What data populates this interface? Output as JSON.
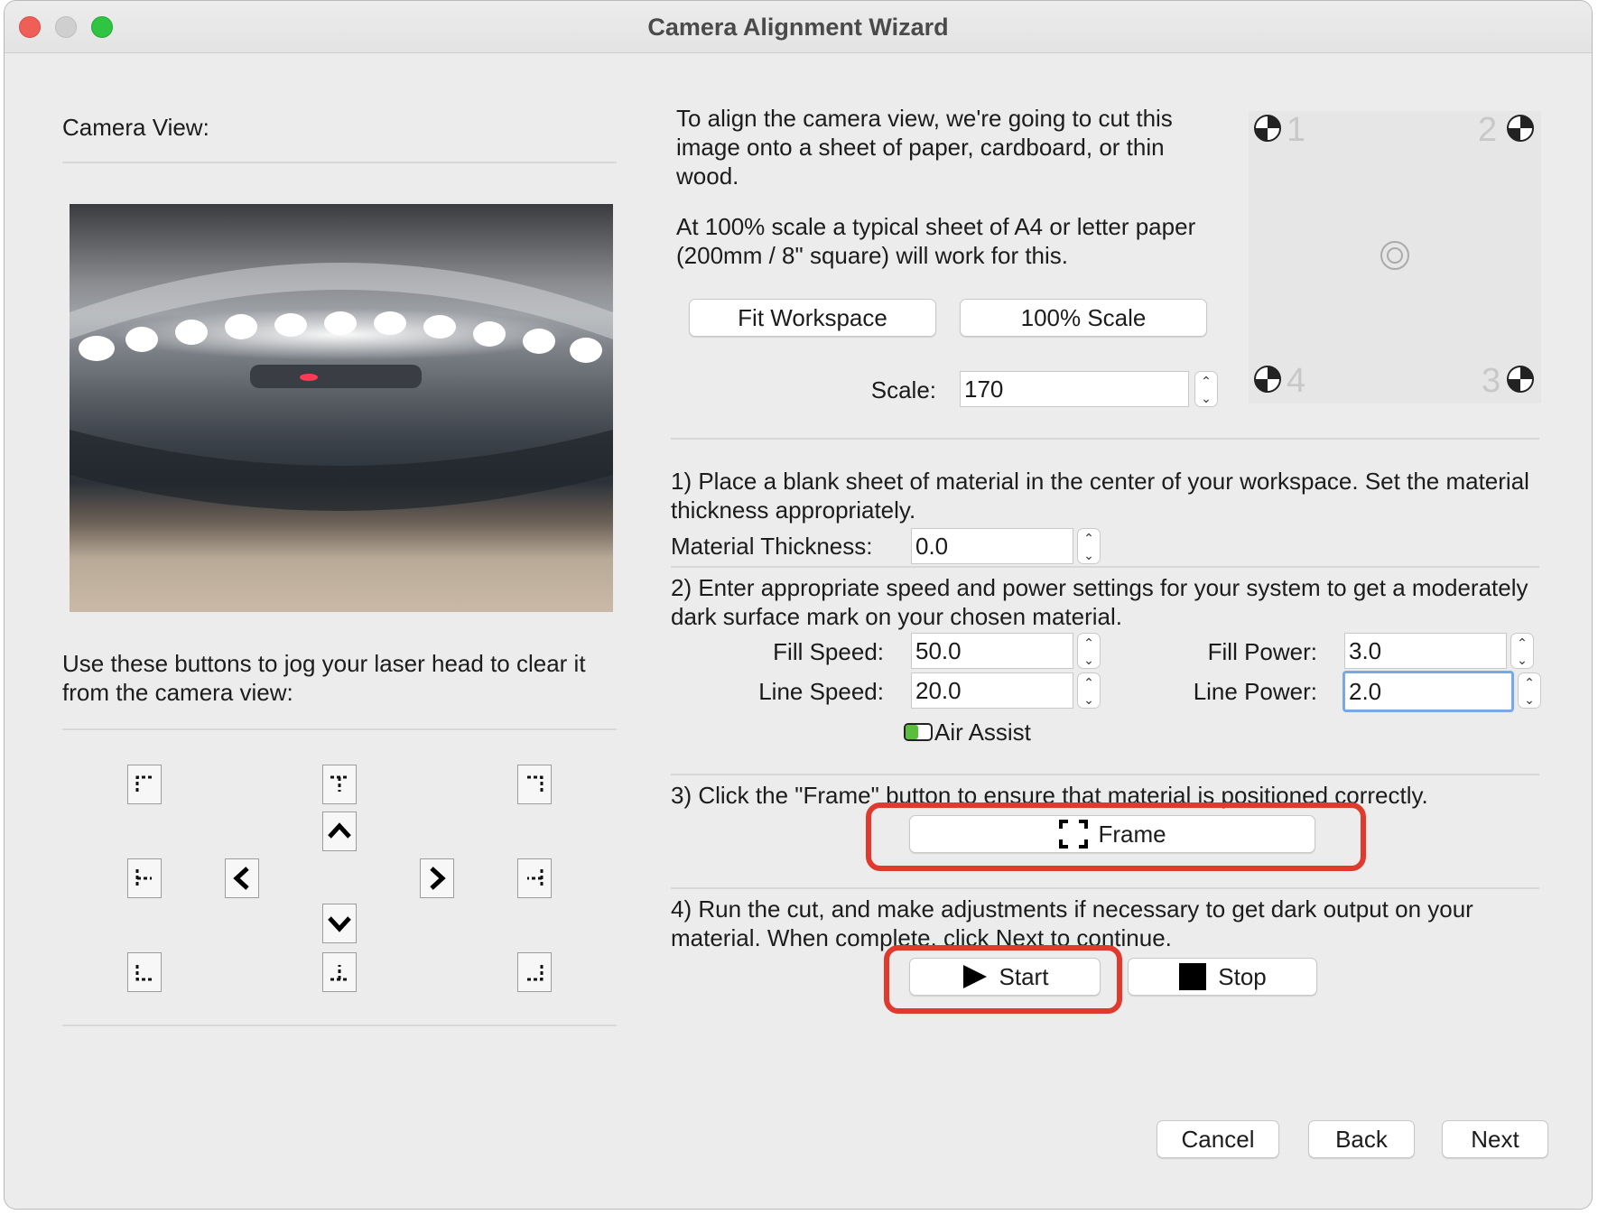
{
  "window": {
    "title": "Camera Alignment Wizard"
  },
  "left": {
    "camera_label": "Camera View:",
    "jog_text": "Use these buttons to jog your laser head to clear it from the camera view:"
  },
  "preview": {
    "intro": "To align the camera view, we're going to cut this image onto a sheet of paper, cardboard, or thin wood.",
    "scale_note": "At 100% scale a typical sheet of A4 or letter paper (200mm / 8\" square) will work for this.",
    "fit_workspace": "Fit Workspace",
    "scale_100": "100% Scale",
    "scale_label": "Scale:",
    "scale_value": "170",
    "corner_numbers": [
      "1",
      "2",
      "3",
      "4"
    ]
  },
  "step1": {
    "text": "1) Place a blank sheet of material in the center of your workspace. Set the material thickness appropriately.",
    "thickness_label": "Material Thickness:",
    "thickness_value": "0.0"
  },
  "step2": {
    "text": "2) Enter appropriate speed and power settings for your system to get a moderately dark surface mark on your chosen material.",
    "fill_speed_label": "Fill Speed:",
    "fill_speed_value": "50.0",
    "fill_power_label": "Fill Power:",
    "fill_power_value": "3.0",
    "line_speed_label": "Line Speed:",
    "line_speed_value": "20.0",
    "line_power_label": "Line Power:",
    "line_power_value": "2.0",
    "air_assist_label": "Air Assist"
  },
  "step3": {
    "text": "3) Click the \"Frame\" button to ensure that material is positioned correctly.",
    "frame_button": "Frame"
  },
  "step4": {
    "text": "4) Run the cut, and make adjustments if necessary to get dark output on your material. When complete, click Next to continue.",
    "start_button": "Start",
    "stop_button": "Stop"
  },
  "footer": {
    "cancel": "Cancel",
    "back": "Back",
    "next": "Next"
  },
  "colors": {
    "highlight": "#e0392e",
    "focus": "#7aa8e6"
  }
}
